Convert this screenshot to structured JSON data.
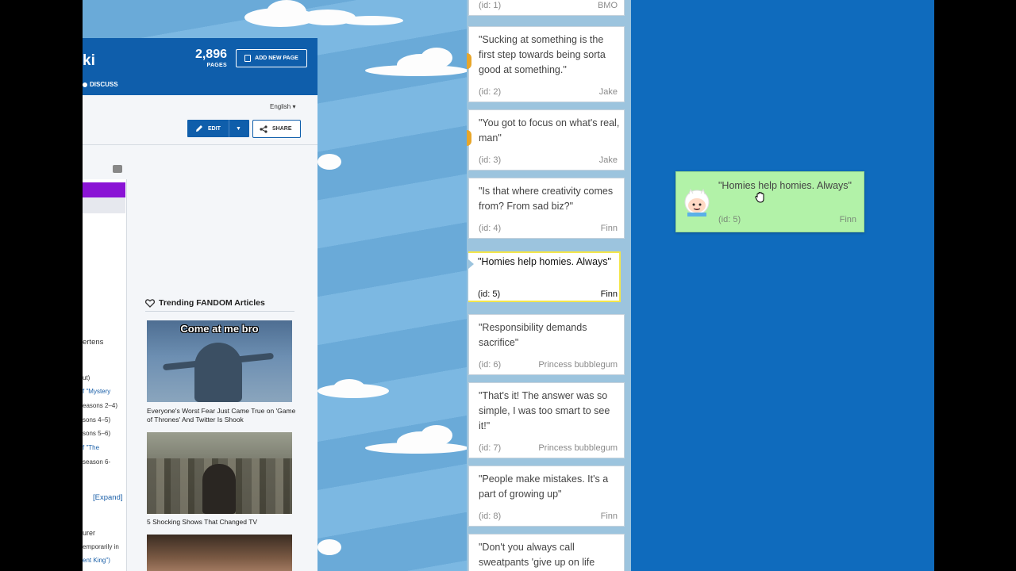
{
  "wiki": {
    "title_fragment": "ki",
    "pages_count": "2,896",
    "pages_label": "PAGES",
    "add_page_label": "ADD NEW PAGE",
    "discuss_label": "DISCUSS",
    "language": "English ▾",
    "edit_label": "EDIT",
    "share_label": "SHARE",
    "left_fragments": [
      "ertens",
      "ut)",
      "f \"Mystery",
      "easons 2–4)",
      "sons 4–5)",
      "sons 5–6)",
      "f \"The",
      " season 6-",
      "[Expand]",
      "urer",
      "emporarily in",
      "ent King\")"
    ],
    "trending_title": "Trending FANDOM Articles",
    "articles": [
      {
        "image_caption": "Come at me bro",
        "title": "Everyone's Worst Fear Just Came True on 'Game of Thrones' And Twitter Is Shook"
      },
      {
        "title": "5 Shocking Shows That Changed TV"
      }
    ]
  },
  "quotes": [
    {
      "quote": "",
      "id": "(id: 1)",
      "author": "BMO"
    },
    {
      "quote": "\"Sucking at something is the first step towards being sorta good at something.\"",
      "id": "(id: 2)",
      "author": "Jake"
    },
    {
      "quote": "\"You got to focus on what's real, man\"",
      "id": "(id: 3)",
      "author": "Jake"
    },
    {
      "quote": "\"Is that where creativity comes from? From sad biz?\"",
      "id": "(id: 4)",
      "author": "Finn"
    },
    {
      "quote": "\"Homies help homies. Always\"",
      "id": "(id: 5)",
      "author": "Finn"
    },
    {
      "quote": "\"Responsibility demands sacrifice\"",
      "id": "(id: 6)",
      "author": "Princess bubblegum"
    },
    {
      "quote": "\"That's it! The answer was so simple, I was too smart to see it!\"",
      "id": "(id: 7)",
      "author": "Princess bubblegum"
    },
    {
      "quote": "\"People make mistakes. It's a part of growing up\"",
      "id": "(id: 8)",
      "author": "Finn"
    },
    {
      "quote": "\"Don't you always call sweatpants 'give up on life",
      "id": "",
      "author": ""
    }
  ],
  "dragging": {
    "quote": "\"Homies help homies. Always\"",
    "id": "(id: 5)",
    "author": "Finn"
  },
  "colors": {
    "list_bg": "#9cc4de",
    "drag_bg": "#b2f2a8",
    "right_bg": "#0f6bbd",
    "wiki_header": "#0f5eab",
    "placeholder_border": "#f4e64a"
  }
}
